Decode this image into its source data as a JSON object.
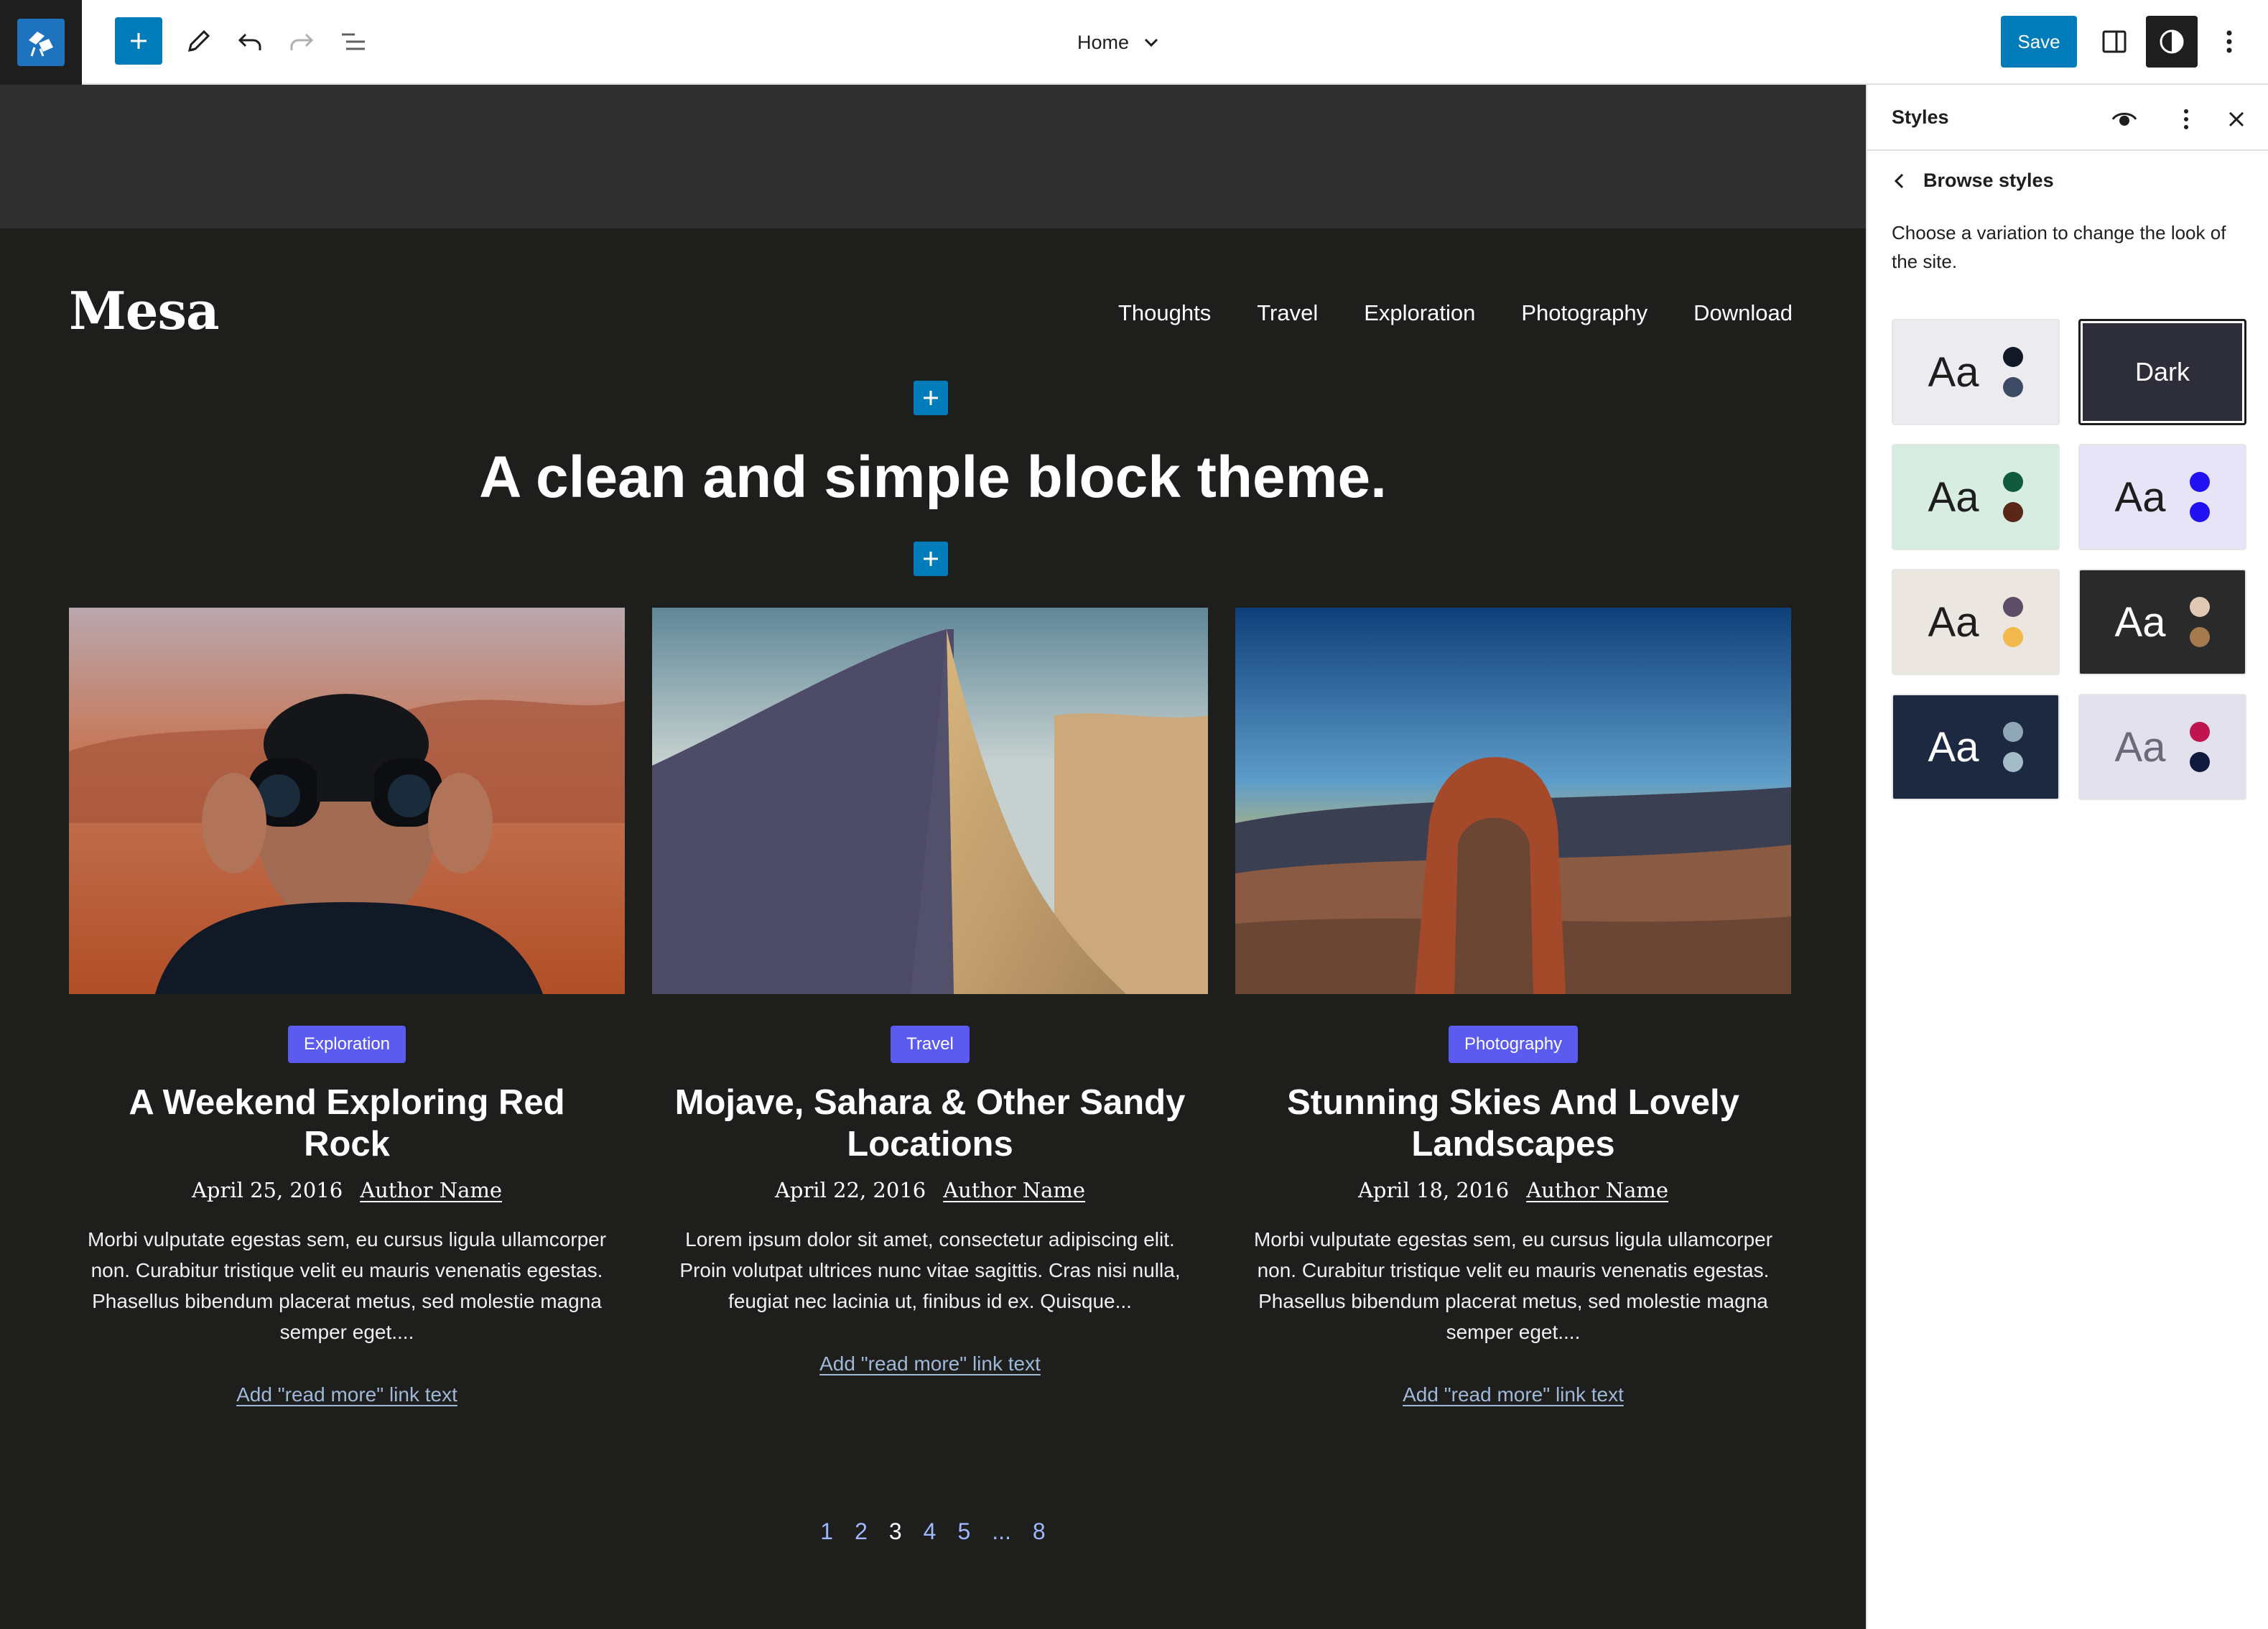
{
  "toolbar": {
    "document_title": "Home",
    "save_label": "Save",
    "icons": [
      "wordpress-site-icon",
      "add-block-icon",
      "edit-pencil-icon",
      "undo-icon",
      "redo-icon",
      "list-view-icon",
      "chevron-down-icon",
      "sidebar-toggle-icon",
      "styles-contrast-icon",
      "more-options-icon"
    ]
  },
  "site": {
    "title": "Mesa",
    "nav": [
      "Thoughts",
      "Travel",
      "Exploration",
      "Photography",
      "Download"
    ],
    "hero": "A clean and simple block theme."
  },
  "posts": [
    {
      "category": "Exploration",
      "title": "A Weekend Exploring Red Rock",
      "date": "April 25, 2016",
      "author": "Author Name",
      "excerpt": "Morbi vulputate egestas sem, eu cursus ligula ullamcorper non. Curabitur tristique velit eu mauris venenatis egestas. Phasellus bibendum placerat metus, sed molestie magna semper eget....",
      "read_more": "Add \"read more\" link text"
    },
    {
      "category": "Travel",
      "title": "Mojave, Sahara & Other Sandy Locations",
      "date": "April 22, 2016",
      "author": "Author Name",
      "excerpt": "Lorem ipsum dolor sit amet, consectetur adipiscing elit. Proin volutpat ultrices nunc vitae sagittis. Cras nisi nulla, feugiat nec lacinia ut, finibus id ex. Quisque...",
      "read_more": "Add \"read more\" link text"
    },
    {
      "category": "Photography",
      "title": "Stunning Skies And Lovely Landscapes",
      "date": "April 18, 2016",
      "author": "Author Name",
      "excerpt": "Morbi vulputate egestas sem, eu cursus ligula ullamcorper non. Curabitur tristique velit eu mauris venenatis egestas. Phasellus bibendum placerat metus, sed molestie magna semper eget....",
      "read_more": "Add \"read more\" link text"
    }
  ],
  "pagination": [
    "1",
    "2",
    "3",
    "4",
    "5",
    "...",
    "8"
  ],
  "pagination_current": "3",
  "sidebar": {
    "title": "Styles",
    "back_label": "Browse styles",
    "description": "Choose a variation to change the look of the site.",
    "variations": [
      {
        "label": "Aa",
        "bg": "#ececf0",
        "text": "#1e1e1e",
        "dots": [
          "#111827",
          "#3d4a63"
        ],
        "selected": false
      },
      {
        "label": "Dark",
        "bg": "#2e2e3a",
        "text": "#ffffff",
        "dots": [],
        "selected": true
      },
      {
        "label": "Aa",
        "bg": "#d8ede2",
        "text": "#1e1e1e",
        "dots": [
          "#0f5b3c",
          "#5a2617"
        ],
        "selected": false
      },
      {
        "label": "Aa",
        "bg": "#e6e4f6",
        "text": "#1e1e1e",
        "dots": [
          "#2212f2",
          "#2212f2"
        ],
        "selected": false
      },
      {
        "label": "Aa",
        "bg": "#ebe6df",
        "text": "#1e1e1e",
        "dots": [
          "#5e4d67",
          "#f2b84b"
        ],
        "selected": false
      },
      {
        "label": "Aa",
        "bg": "#2a2a2a",
        "text": "#ffffff",
        "dots": [
          "#e0c9b4",
          "#a57a4e"
        ],
        "selected": false
      },
      {
        "label": "Aa",
        "bg": "#1c2940",
        "text": "#ffffff",
        "dots": [
          "#8fa6b6",
          "#a3bcc8"
        ],
        "selected": false
      },
      {
        "label": "Aa",
        "bg": "#e3e1ee",
        "text": "#6a6a7a",
        "dots": [
          "#c0144f",
          "#0f1a3d"
        ],
        "selected": false
      }
    ]
  },
  "colors": {
    "accent": "#007cba",
    "canvas_bg": "#1e1e1c",
    "pill": "#5b5bf0",
    "link": "#9fb8d8"
  }
}
